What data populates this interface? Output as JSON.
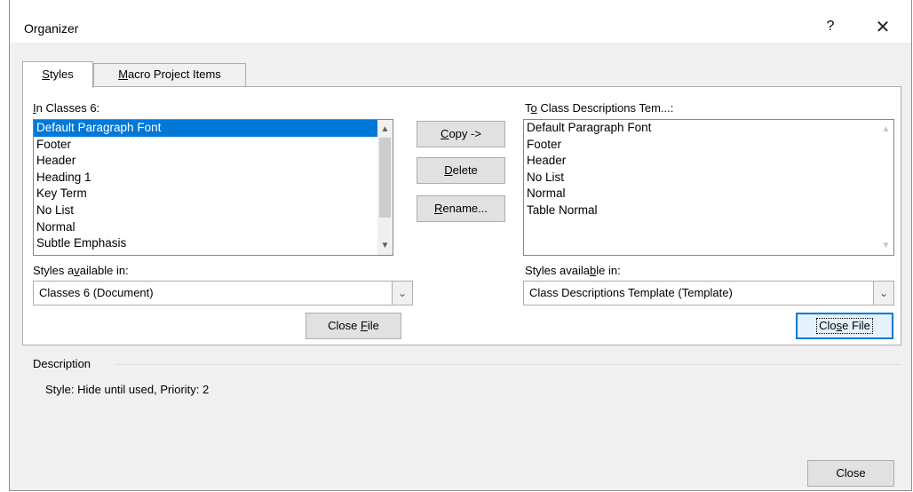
{
  "window": {
    "title": "Organizer",
    "help": "?",
    "close": "✕"
  },
  "tabs": [
    {
      "prefix": "",
      "underline": "S",
      "rest": "tyles"
    },
    {
      "prefix": "",
      "underline": "M",
      "rest": "acro Project Items"
    }
  ],
  "left": {
    "label_underline": "I",
    "label_rest": "n Classes 6:",
    "items": [
      "Default Paragraph Font",
      "Footer",
      "Header",
      "Heading 1",
      "Key Term",
      "No List",
      "Normal",
      "Subtle Emphasis"
    ],
    "selected_index": 0,
    "avail_pre": "Styles a",
    "avail_u": "v",
    "avail_post": "ailable in:",
    "combo_value": "Classes 6 (Document)",
    "close_pre": "Close ",
    "close_u": "F",
    "close_post": "ile"
  },
  "middle": {
    "copy_u": "C",
    "copy_rest": "opy ->",
    "delete_u": "D",
    "delete_rest": "elete",
    "rename_u": "R",
    "rename_rest": "ename..."
  },
  "right": {
    "label_pre": "T",
    "label_u": "o",
    "label_post": " Class Descriptions Tem...:",
    "items": [
      "Default Paragraph Font",
      "Footer",
      "Header",
      "No List",
      "Normal",
      "Table Normal"
    ],
    "avail_pre": "Styles availa",
    "avail_u": "b",
    "avail_post": "le in:",
    "combo_value": "Class Descriptions Template (Template)",
    "close_pre": "Clo",
    "close_u": "s",
    "close_post": "e File"
  },
  "description": {
    "heading": "Description",
    "text": "Style: Hide until used, Priority: 2"
  },
  "footer": {
    "close_label": "Close"
  },
  "icons": {
    "scroll_up": "up-arrow",
    "scroll_down": "down-arrow",
    "combo": "chevron-down"
  }
}
